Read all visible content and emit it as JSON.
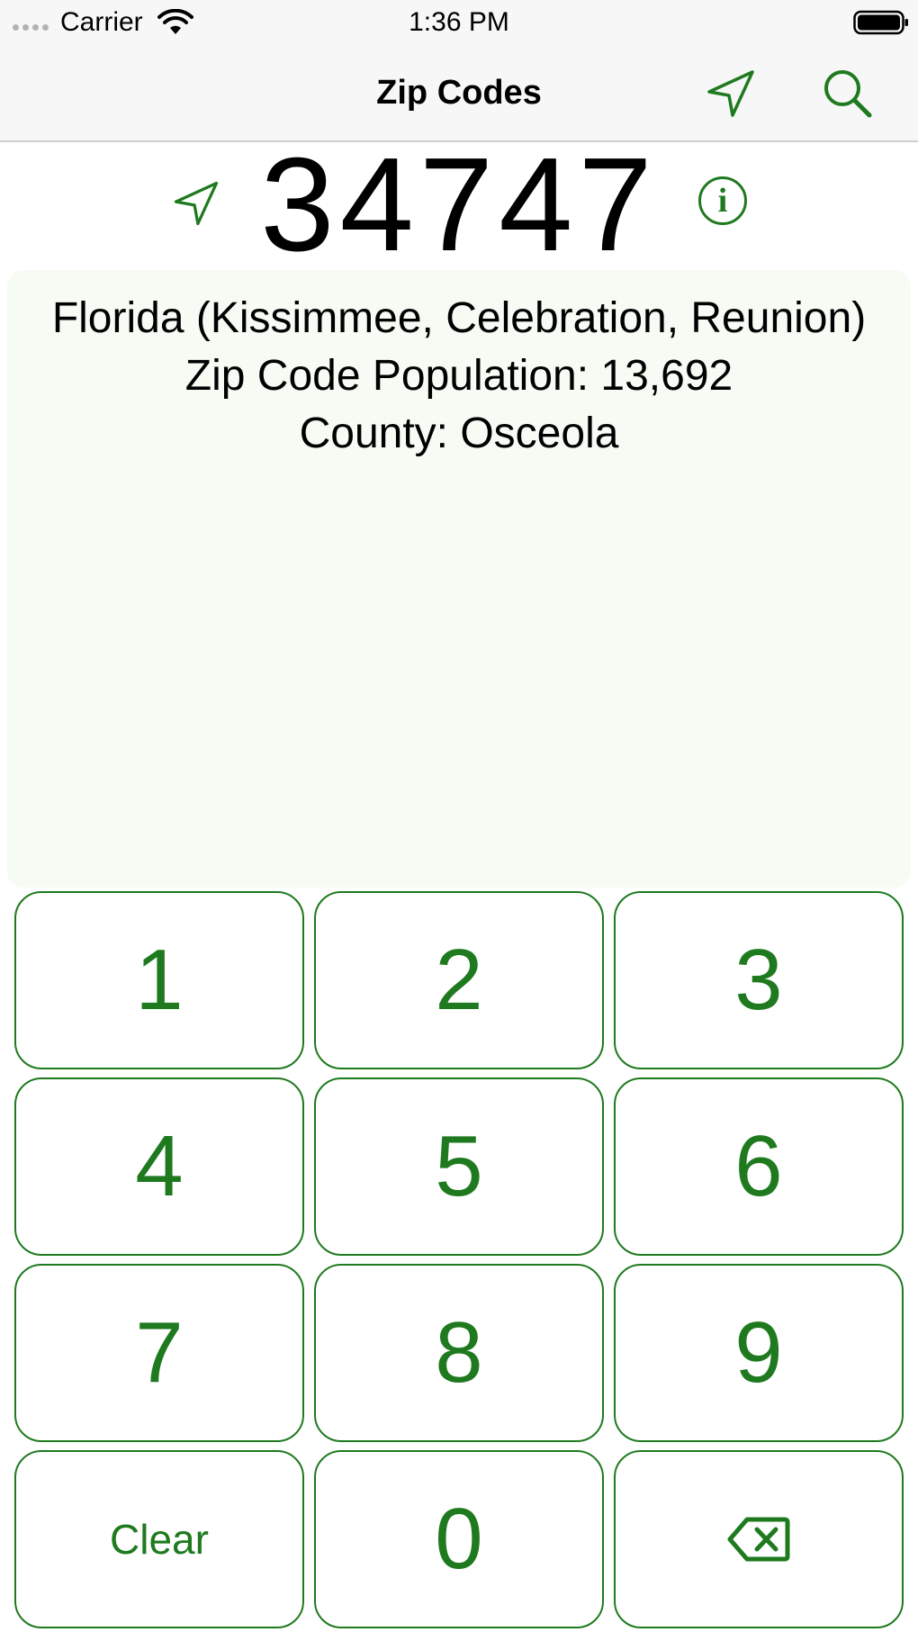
{
  "status_bar": {
    "carrier": "Carrier",
    "time": "1:36 PM"
  },
  "nav": {
    "title": "Zip Codes"
  },
  "zip": {
    "value": "34747",
    "info_glyph": "i"
  },
  "info": {
    "state_line": "Florida (Kissimmee, Celebration, Reunion)",
    "population_line": "Zip Code Population: 13,692",
    "county_line": "County: Osceola"
  },
  "keypad": {
    "keys": [
      "1",
      "2",
      "3",
      "4",
      "5",
      "6",
      "7",
      "8",
      "9"
    ],
    "clear_label": "Clear",
    "zero_label": "0"
  },
  "icons": {
    "location": "location-arrow-icon",
    "search": "search-icon",
    "info": "info-icon",
    "backspace": "backspace-icon",
    "wifi": "wifi-icon",
    "battery": "battery-icon"
  },
  "colors": {
    "accent": "#1f7a1f",
    "panel_background": "#f6fbf4",
    "bar_background": "#f7f7f7"
  }
}
